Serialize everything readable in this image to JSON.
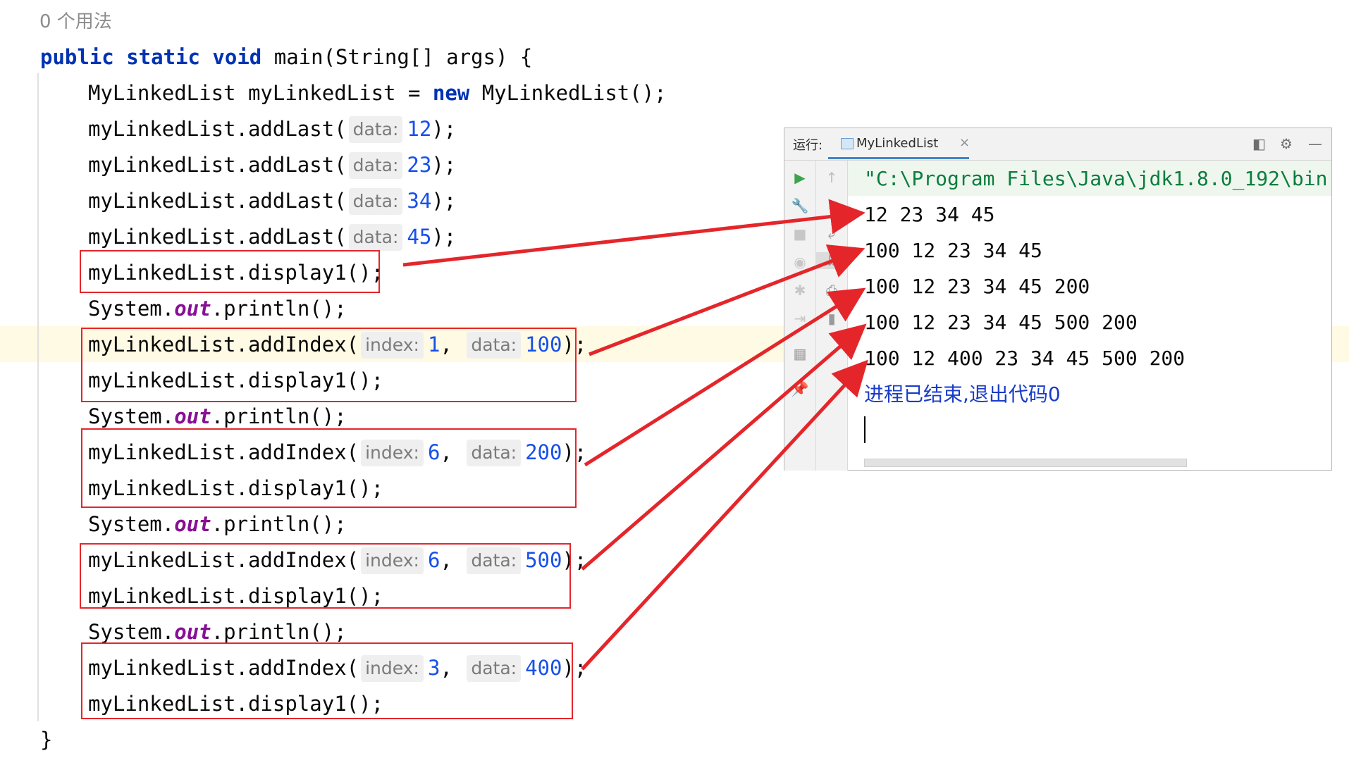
{
  "usage_hint": "0 个用法",
  "code": {
    "main_sig": {
      "kw": "public static void",
      "rest": " main(String[] args) {"
    },
    "decl": {
      "pre": "MyLinkedList myLinkedList = ",
      "kw": "new",
      "post": " MyLinkedList();"
    },
    "add_last": [
      {
        "pre": "myLinkedList.addLast(",
        "hint": "data:",
        "value": "12",
        "post": ");"
      },
      {
        "pre": "myLinkedList.addLast(",
        "hint": "data:",
        "value": "23",
        "post": ");"
      },
      {
        "pre": "myLinkedList.addLast(",
        "hint": "data:",
        "value": "34",
        "post": ");"
      },
      {
        "pre": "myLinkedList.addLast(",
        "hint": "data:",
        "value": "45",
        "post": ");"
      }
    ],
    "display_call": "myLinkedList.display1();",
    "println": {
      "pre": "System.",
      "field": "out",
      "post": ".println();"
    },
    "add_index": [
      {
        "pre": "myLinkedList.addIndex(",
        "hint1": "index:",
        "index": "1",
        "sep": ", ",
        "hint2": "data:",
        "data": "100",
        "post": ");"
      },
      {
        "pre": "myLinkedList.addIndex(",
        "hint1": "index:",
        "index": "6",
        "sep": ", ",
        "hint2": "data:",
        "data": "200",
        "post": ");"
      },
      {
        "pre": "myLinkedList.addIndex(",
        "hint1": "index:",
        "index": "6",
        "sep": ", ",
        "hint2": "data:",
        "data": "500",
        "post": ");"
      },
      {
        "pre": "myLinkedList.addIndex(",
        "hint1": "index:",
        "index": "3",
        "sep": ", ",
        "hint2": "data:",
        "data": "400",
        "post": ");"
      }
    ],
    "close_brace": "}"
  },
  "run_panel": {
    "label": "运行:",
    "tab_title": "MyLinkedList",
    "tab_close": "×",
    "command": "\"C:\\Program Files\\Java\\jdk1.8.0_192\\bin",
    "output_lines": [
      "12 23 34 45",
      "100 12 23 34 45",
      "100 12 23 34 45 200",
      "100 12 23 34 45 500 200",
      "100 12 400 23 34 45 500 200"
    ],
    "exit_message": "进程已结束,退出代码0"
  },
  "colors": {
    "annotation": "#e4262b",
    "keyword": "#0033b3",
    "number": "#1750eb",
    "field": "#871094"
  }
}
